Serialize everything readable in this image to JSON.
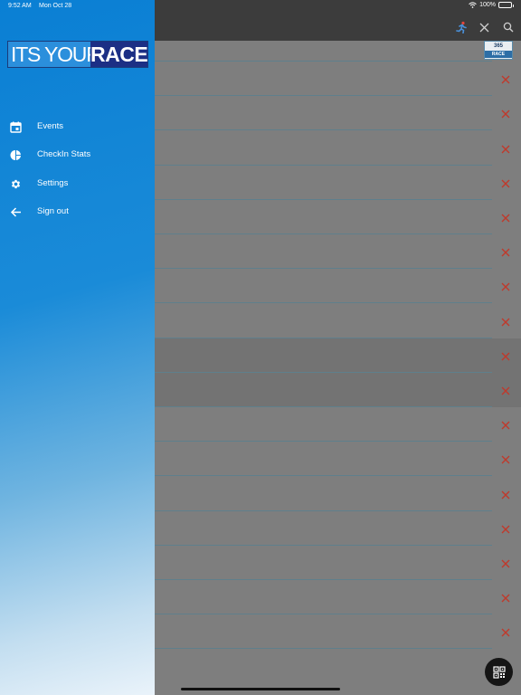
{
  "status_bar": {
    "time": "9:52 AM",
    "date": "Mon Oct 28",
    "battery_percent": "100%",
    "battery_level": 1.0
  },
  "logo": {
    "left_text": "ITS YOUR",
    "right_text": "RACE"
  },
  "menu": {
    "items": [
      {
        "label": "Events",
        "icon": "calendar-icon"
      },
      {
        "label": "CheckIn Stats",
        "icon": "pie-chart-icon"
      },
      {
        "label": "Settings",
        "icon": "gear-icon"
      },
      {
        "label": "Sign out",
        "icon": "arrow-left-icon"
      }
    ]
  },
  "background_app": {
    "badge": {
      "top": "365",
      "bottom": "RACE"
    },
    "row_count": 18,
    "highlighted_rows": [
      9,
      10
    ]
  },
  "colors": {
    "drawer_top": "#0a7fd4",
    "drawer_bottom": "#eaf3fa",
    "navbar": "#3c3c3c",
    "delete_x": "#c0392b",
    "logo_dark": "#1c2f85"
  }
}
